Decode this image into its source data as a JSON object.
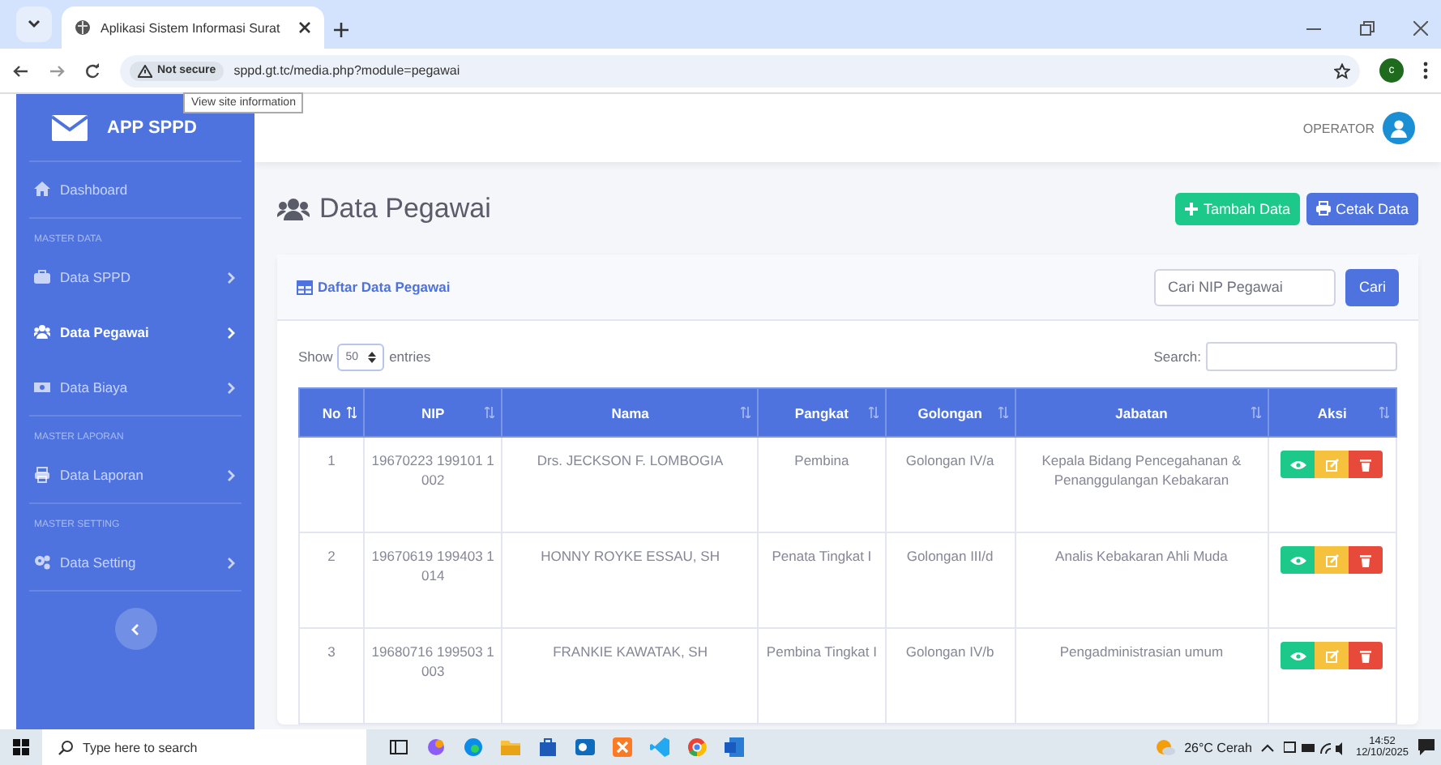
{
  "browser": {
    "tab_title": "Aplikasi Sistem Informasi Surat",
    "not_secure": "Not secure",
    "url": "sppd.gt.tc/media.php?module=pegawai",
    "tooltip": "View site information",
    "profile_initial": "c"
  },
  "sidebar": {
    "brand": "APP SPPD",
    "items": [
      {
        "kind": "link",
        "label": "Dashboard",
        "selected": false
      },
      {
        "kind": "section",
        "label": "MASTER DATA"
      },
      {
        "kind": "menu",
        "label": "Data SPPD",
        "selected": false
      },
      {
        "kind": "menu",
        "label": "Data Pegawai",
        "selected": true
      },
      {
        "kind": "menu",
        "label": "Data Biaya",
        "selected": false
      },
      {
        "kind": "section",
        "label": "MASTER LAPORAN"
      },
      {
        "kind": "menu",
        "label": "Data Laporan",
        "selected": false
      },
      {
        "kind": "section",
        "label": "MASTER SETTING"
      },
      {
        "kind": "menu",
        "label": "Data Setting",
        "selected": false
      }
    ]
  },
  "topbar": {
    "user": "OPERATOR"
  },
  "page": {
    "title": "Data Pegawai",
    "buttons": [
      {
        "label": "Tambah Data",
        "kind": "add"
      },
      {
        "label": "Cetak Data",
        "kind": "print"
      }
    ]
  },
  "card": {
    "title": "Daftar Data Pegawai",
    "search_placeholder": "Cari NIP Pegawai",
    "search_button": "Cari",
    "show_label": "Show",
    "page_size": "50",
    "entries_label": "entries",
    "filter_label": "Search:"
  },
  "table": {
    "columns": [
      "No",
      "NIP",
      "Nama",
      "Pangkat",
      "Golongan",
      "Jabatan",
      "Aksi"
    ],
    "rows": [
      {
        "no": "1",
        "nip": "19670223 199101 1 002",
        "nama": "Drs. JECKSON F. LOMBOGIA",
        "pangkat": "Pembina",
        "golongan": "Golongan IV/a",
        "jabatan": "Kepala Bidang Pencegahanan & Penanggulangan Kebakaran"
      },
      {
        "no": "2",
        "nip": "19670619 199403 1 014",
        "nama": "HONNY ROYKE ESSAU, SH",
        "pangkat": "Penata Tingkat I",
        "golongan": "Golongan III/d",
        "jabatan": "Analis Kebakaran Ahli Muda"
      },
      {
        "no": "3",
        "nip": "19680716 199503 1 003",
        "nama": "FRANKIE KAWATAK, SH",
        "pangkat": "Pembina Tingkat I",
        "golongan": "Golongan IV/b",
        "jabatan": "Pengadministrasian umum"
      }
    ]
  },
  "taskbar": {
    "search_placeholder": "Type here to search",
    "weather": "26°C Cerah",
    "time": "14:52",
    "date": "12/10/2025"
  }
}
